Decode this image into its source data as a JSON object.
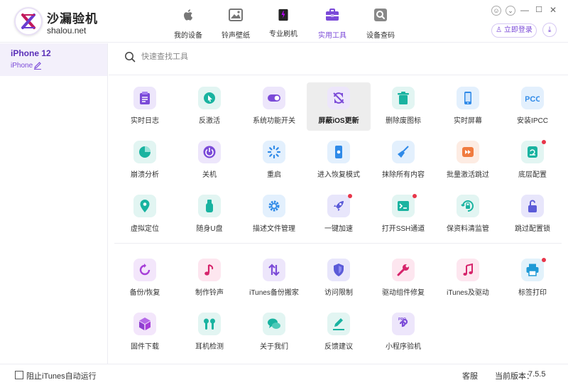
{
  "brand": {
    "name": "沙漏验机",
    "domain": "shalou.net"
  },
  "nav": [
    {
      "label": "我的设备",
      "icon": "apple-icon"
    },
    {
      "label": "铃声壁纸",
      "icon": "wallpaper-icon"
    },
    {
      "label": "专业刷机",
      "icon": "flash-phone-icon"
    },
    {
      "label": "实用工具",
      "icon": "toolbox-icon",
      "active": true
    },
    {
      "label": "设备查码",
      "icon": "search-device-icon"
    }
  ],
  "header": {
    "login_label": "立即登录"
  },
  "device": {
    "name": "iPhone 12",
    "model": "iPhone"
  },
  "search": {
    "placeholder": "快速查找工具"
  },
  "tools": [
    {
      "label": "实时日志",
      "icon": "clipboard-icon"
    },
    {
      "label": "反激活",
      "icon": "cursor-click-icon"
    },
    {
      "label": "系统功能开关",
      "icon": "toggle-icon"
    },
    {
      "label": "屏蔽iOS更新",
      "icon": "block-update-icon",
      "selected": true
    },
    {
      "label": "删除废图标",
      "icon": "trash-icon"
    },
    {
      "label": "实时屏幕",
      "icon": "phone-screen-icon"
    },
    {
      "label": "安装IPCC",
      "icon": "ipcc-icon"
    },
    {
      "label": "崩溃分析",
      "icon": "pie-chart-icon"
    },
    {
      "label": "关机",
      "icon": "power-icon"
    },
    {
      "label": "重启",
      "icon": "restart-icon"
    },
    {
      "label": "进入恢复模式",
      "icon": "recovery-mode-icon"
    },
    {
      "label": "抹除所有内容",
      "icon": "broom-icon"
    },
    {
      "label": "批量激活跳过",
      "icon": "skip-forward-icon"
    },
    {
      "label": "底层配置",
      "icon": "config-icon",
      "badge": true
    },
    {
      "label": "虚拟定位",
      "icon": "location-pin-icon"
    },
    {
      "label": "随身U盘",
      "icon": "usb-drive-icon"
    },
    {
      "label": "描述文件管理",
      "icon": "settings-gear-icon"
    },
    {
      "label": "一键加速",
      "icon": "rocket-icon",
      "badge": true
    },
    {
      "label": "打开SSH通道",
      "icon": "terminal-icon",
      "badge": true
    },
    {
      "label": "保资料清监管",
      "icon": "clean-lock-icon"
    },
    {
      "label": "跳过配置锁",
      "icon": "unlock-icon"
    },
    {
      "label": "备份/恢复",
      "icon": "backup-restore-icon"
    },
    {
      "label": "制作铃声",
      "icon": "music-note-icon"
    },
    {
      "label": "iTunes备份搬家",
      "icon": "transfer-icon"
    },
    {
      "label": "访问限制",
      "icon": "shield-icon"
    },
    {
      "label": "驱动组件修复",
      "icon": "wrench-icon"
    },
    {
      "label": "iTunes及驱动",
      "icon": "itunes-icon"
    },
    {
      "label": "标签打印",
      "icon": "printer-icon",
      "badge": true
    },
    {
      "label": "固件下载",
      "icon": "package-box-icon"
    },
    {
      "label": "耳机检测",
      "icon": "earbuds-icon"
    },
    {
      "label": "关于我们",
      "icon": "chat-bubbles-icon"
    },
    {
      "label": "反馈建议",
      "icon": "feedback-edit-icon"
    },
    {
      "label": "小程序验机",
      "icon": "mini-program-icon"
    }
  ],
  "footer": {
    "checkbox_label": "阻止iTunes自动运行",
    "service_label": "客服",
    "version_label": "当前版本：",
    "version_value": "7.5.5"
  },
  "colors": {
    "accent": "#7b4ad8",
    "badge": "#e8364a"
  }
}
